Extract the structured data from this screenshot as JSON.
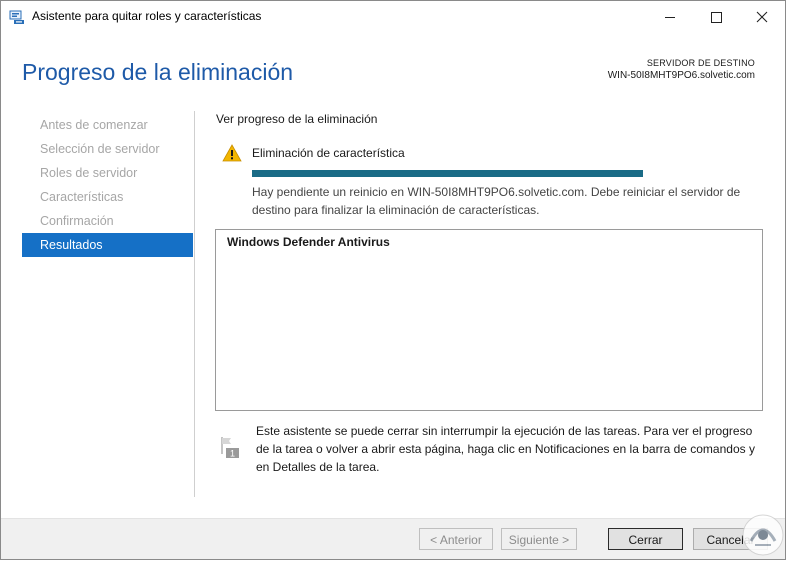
{
  "window": {
    "title": "Asistente para quitar roles y características"
  },
  "header": {
    "page_title": "Progreso de la eliminación",
    "destination_label": "SERVIDOR DE DESTINO",
    "destination_server": "WIN-50I8MHT9PO6.solvetic.com"
  },
  "nav": {
    "items": [
      {
        "label": "Antes de comenzar",
        "active": false
      },
      {
        "label": "Selección de servidor",
        "active": false
      },
      {
        "label": "Roles de servidor",
        "active": false
      },
      {
        "label": "Características",
        "active": false
      },
      {
        "label": "Confirmación",
        "active": false
      },
      {
        "label": "Resultados",
        "active": true
      }
    ]
  },
  "content": {
    "section_title": "Ver progreso de la eliminación",
    "operation_title": "Eliminación de característica",
    "progress_fraction": 1.0,
    "message": "Hay pendiente un reinicio en WIN-50I8MHT9PO6.solvetic.com. Debe reiniciar el servidor de destino para finalizar la eliminación de características.",
    "results": [
      "Windows Defender Antivirus"
    ],
    "note": "Este asistente se puede cerrar sin interrumpir la ejecución de las tareas. Para ver el progreso de la tarea o volver a abrir esta página, haga clic en Notificaciones en la barra de comandos y en Detalles de la tarea.",
    "note_badge": "1"
  },
  "footer": {
    "prev_label": "< Anterior",
    "next_label": "Siguiente >",
    "close_label": "Cerrar",
    "cancel_label": "Cancelar"
  },
  "colors": {
    "accent": "#1570c6",
    "title_blue": "#1e5aa8",
    "progress": "#1a6b86",
    "warning": "#f2b600"
  },
  "icons": {
    "app": "server-manager-icon",
    "warning": "warning-icon",
    "note": "notification-flag-icon",
    "watermark": "watermark-logo"
  }
}
